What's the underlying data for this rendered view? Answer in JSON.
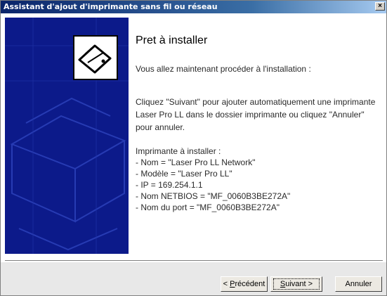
{
  "window": {
    "title": "Assistant d'ajout d'imprimante sans fil ou réseau",
    "close_glyph": "×"
  },
  "side_panel": {
    "accent_color": "#0c1a8a",
    "icon": "printer-icon"
  },
  "main": {
    "heading": "Pret à installer",
    "intro": "Vous allez maintenant procéder à l'installation :",
    "instructions": "Cliquez \"Suivant\" pour ajouter automatiquement une imprimante Laser Pro LL dans le dossier imprimante ou cliquez \"Annuler\" pour annuler.",
    "details_header": "Imprimante à installer :",
    "details": [
      "- Nom = \"Laser Pro LL Network\"",
      "- Modèle = \"Laser Pro LL\"",
      "- IP = 169.254.1.1",
      "- Nom NETBIOS = \"MF_0060B3BE272A\"",
      "- Nom du port = \"MF_0060B3BE272A\""
    ]
  },
  "buttons": {
    "prev_prefix": "< ",
    "prev_mnemonic": "P",
    "prev_rest": "récédent",
    "next_mnemonic": "S",
    "next_rest": "uivant >",
    "cancel": "Annuler"
  }
}
